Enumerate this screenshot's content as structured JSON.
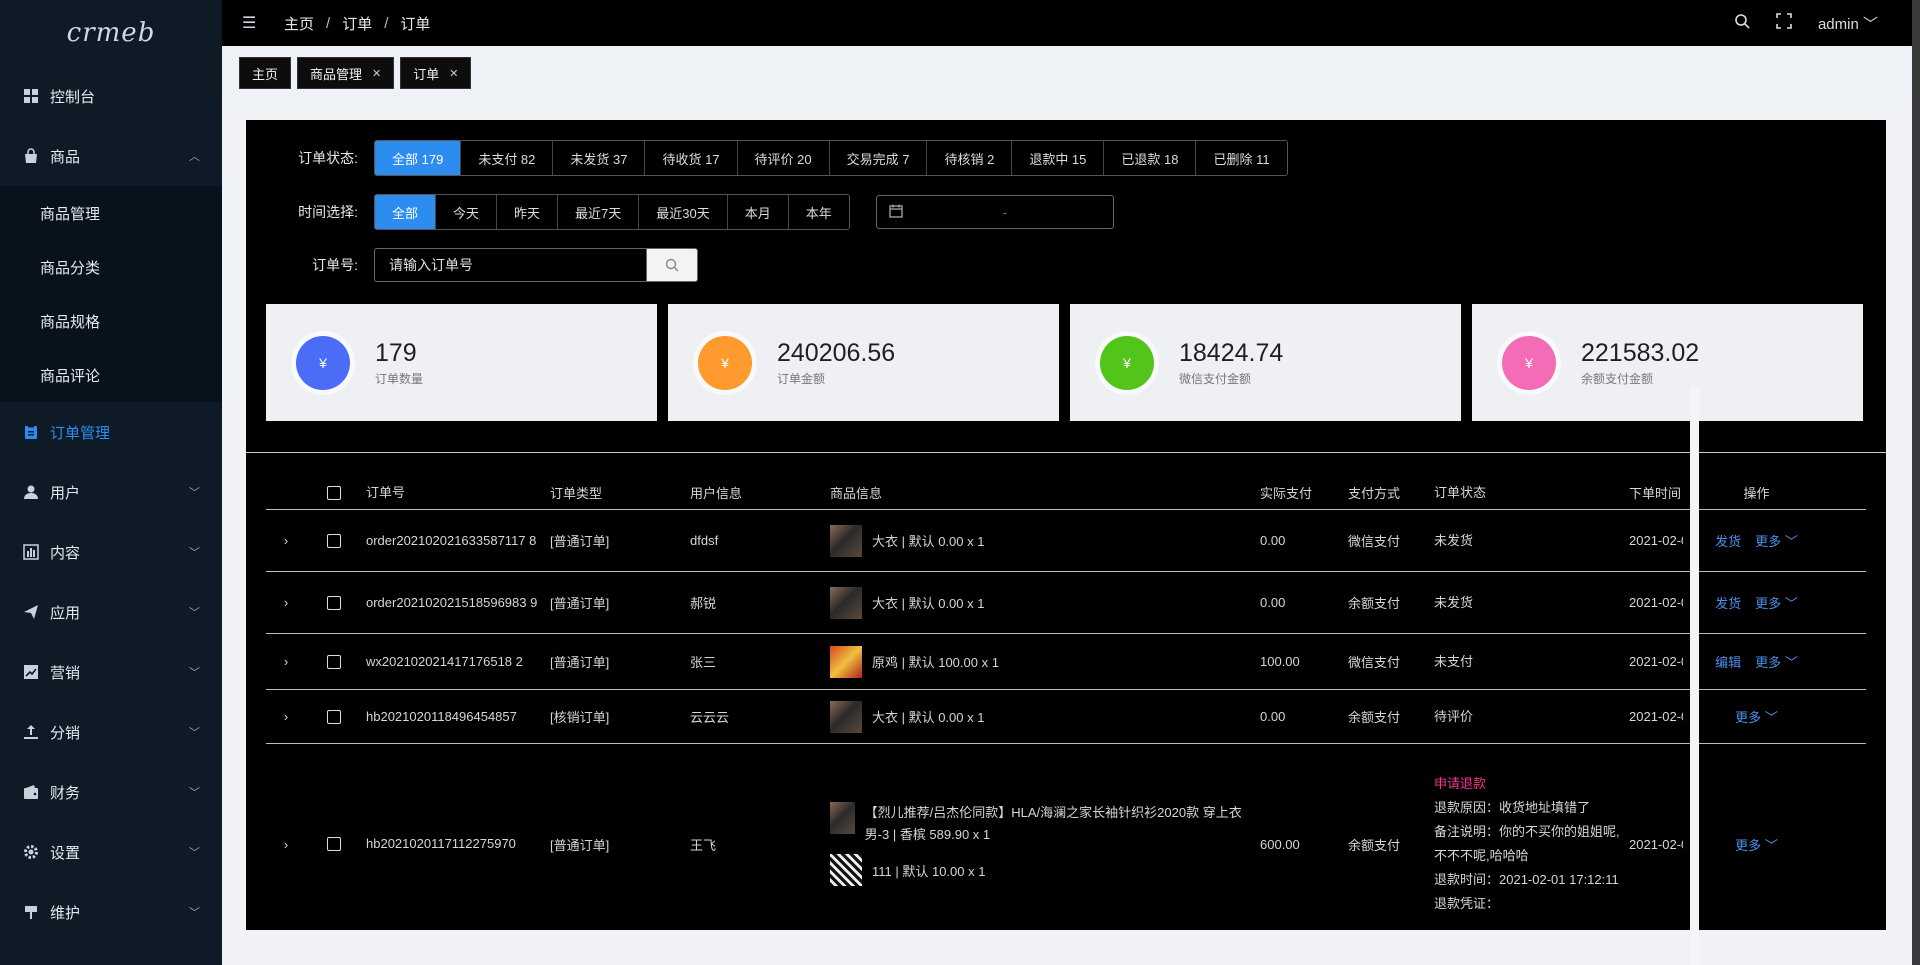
{
  "sidebar": {
    "logo": "crmeb",
    "items": [
      {
        "label": "控制台",
        "icon": "dashboard-icon"
      },
      {
        "label": "商品",
        "icon": "bag-icon",
        "expanded": true,
        "children": [
          "商品管理",
          "商品分类",
          "商品规格",
          "商品评论"
        ]
      },
      {
        "label": "订单管理",
        "icon": "clipboard-icon",
        "active": true
      },
      {
        "label": "用户",
        "icon": "user-icon"
      },
      {
        "label": "内容",
        "icon": "chart-icon"
      },
      {
        "label": "应用",
        "icon": "send-icon"
      },
      {
        "label": "营销",
        "icon": "trend-icon"
      },
      {
        "label": "分销",
        "icon": "upload-icon"
      },
      {
        "label": "财务",
        "icon": "wallet-icon"
      },
      {
        "label": "设置",
        "icon": "gear-icon"
      },
      {
        "label": "维护",
        "icon": "tool-icon"
      }
    ]
  },
  "header": {
    "breadcrumb": [
      "主页",
      "订单",
      "订单"
    ],
    "user": "admin"
  },
  "tabs": [
    {
      "label": "主页",
      "closable": false
    },
    {
      "label": "商品管理",
      "closable": true
    },
    {
      "label": "订单",
      "closable": true
    }
  ],
  "filters": {
    "status_label": "订单状态:",
    "status_options": [
      "全部 179",
      "未支付 82",
      "未发货 37",
      "待收货 17",
      "待评价 20",
      "交易完成 7",
      "待核销 2",
      "退款中 15",
      "已退款 18",
      "已删除 11"
    ],
    "time_label": "时间选择:",
    "time_options": [
      "全部",
      "今天",
      "昨天",
      "最近7天",
      "最近30天",
      "本月",
      "本年"
    ],
    "date_dash": "-",
    "order_no_label": "订单号:",
    "order_no_placeholder": "请输入订单号"
  },
  "stats": [
    {
      "value": "179",
      "label": "订单数量",
      "color": "#4a6cf7"
    },
    {
      "value": "240206.56",
      "label": "订单金额",
      "color": "#ff9a2e"
    },
    {
      "value": "18424.74",
      "label": "微信支付金额",
      "color": "#52c41a"
    },
    {
      "value": "221583.02",
      "label": "余额支付金额",
      "color": "#f56cb6"
    }
  ],
  "table": {
    "headers": [
      "订单号",
      "订单类型",
      "用户信息",
      "商品信息",
      "实际支付",
      "支付方式",
      "订单状态",
      "下单时间",
      "操作"
    ],
    "rows": [
      {
        "order_no": "order202102021633587117 8",
        "type": "[普通订单]",
        "user": "dfdsf",
        "goods": [
          {
            "thumb": "coat",
            "text": "大衣 | 默认 0.00 x 1"
          }
        ],
        "pay": "0.00",
        "payway": "微信支付",
        "status": [
          "未发货"
        ],
        "time": "2021-02-0",
        "ops": [
          "发货",
          "更多"
        ]
      },
      {
        "order_no": "order202102021518596983 9",
        "type": "[普通订单]",
        "user": "郝锐",
        "goods": [
          {
            "thumb": "coat",
            "text": "大衣 | 默认 0.00 x 1"
          }
        ],
        "pay": "0.00",
        "payway": "余额支付",
        "status": [
          "未发货"
        ],
        "time": "2021-02-0",
        "ops": [
          "发货",
          "更多"
        ]
      },
      {
        "order_no": "wx202102021417176518 2",
        "type": "[普通订单]",
        "user": "张三",
        "goods": [
          {
            "thumb": "red",
            "text": "原鸡 | 默认 100.00 x 1"
          }
        ],
        "pay": "100.00",
        "payway": "微信支付",
        "status": [
          "未支付"
        ],
        "time": "2021-02-0",
        "ops": [
          "编辑",
          "更多"
        ]
      },
      {
        "order_no": "hb2021020118496454857",
        "type": "[核销订单]",
        "user": "云云云",
        "goods": [
          {
            "thumb": "coat",
            "text": "大衣 | 默认 0.00 x 1"
          }
        ],
        "pay": "0.00",
        "payway": "余额支付",
        "status": [
          "待评价"
        ],
        "time": "2021-02-0",
        "ops": [
          "更多"
        ]
      },
      {
        "order_no": "hb2021020117112275970",
        "type": "[普通订单]",
        "user": "王飞",
        "goods": [
          {
            "thumb": "coat",
            "text": "【烈儿推荐/吕杰伦同款】HLA/海澜之家长袖针织衫2020款 穿上衣男-3 | 香槟 589.90 x 1"
          },
          {
            "thumb": "qr",
            "text": "111 | 默认 10.00 x 1"
          }
        ],
        "pay": "600.00",
        "payway": "余额支付",
        "status": [
          "申请退款",
          "退款原因：收货地址填错了",
          "备注说明：你的不买你的姐姐呢,不不不呢,哈哈哈",
          "退款时间：2021-02-01 17:12:11",
          "退款凭证："
        ],
        "time": "2021-02-0",
        "ops": [
          "更多"
        ]
      }
    ]
  }
}
